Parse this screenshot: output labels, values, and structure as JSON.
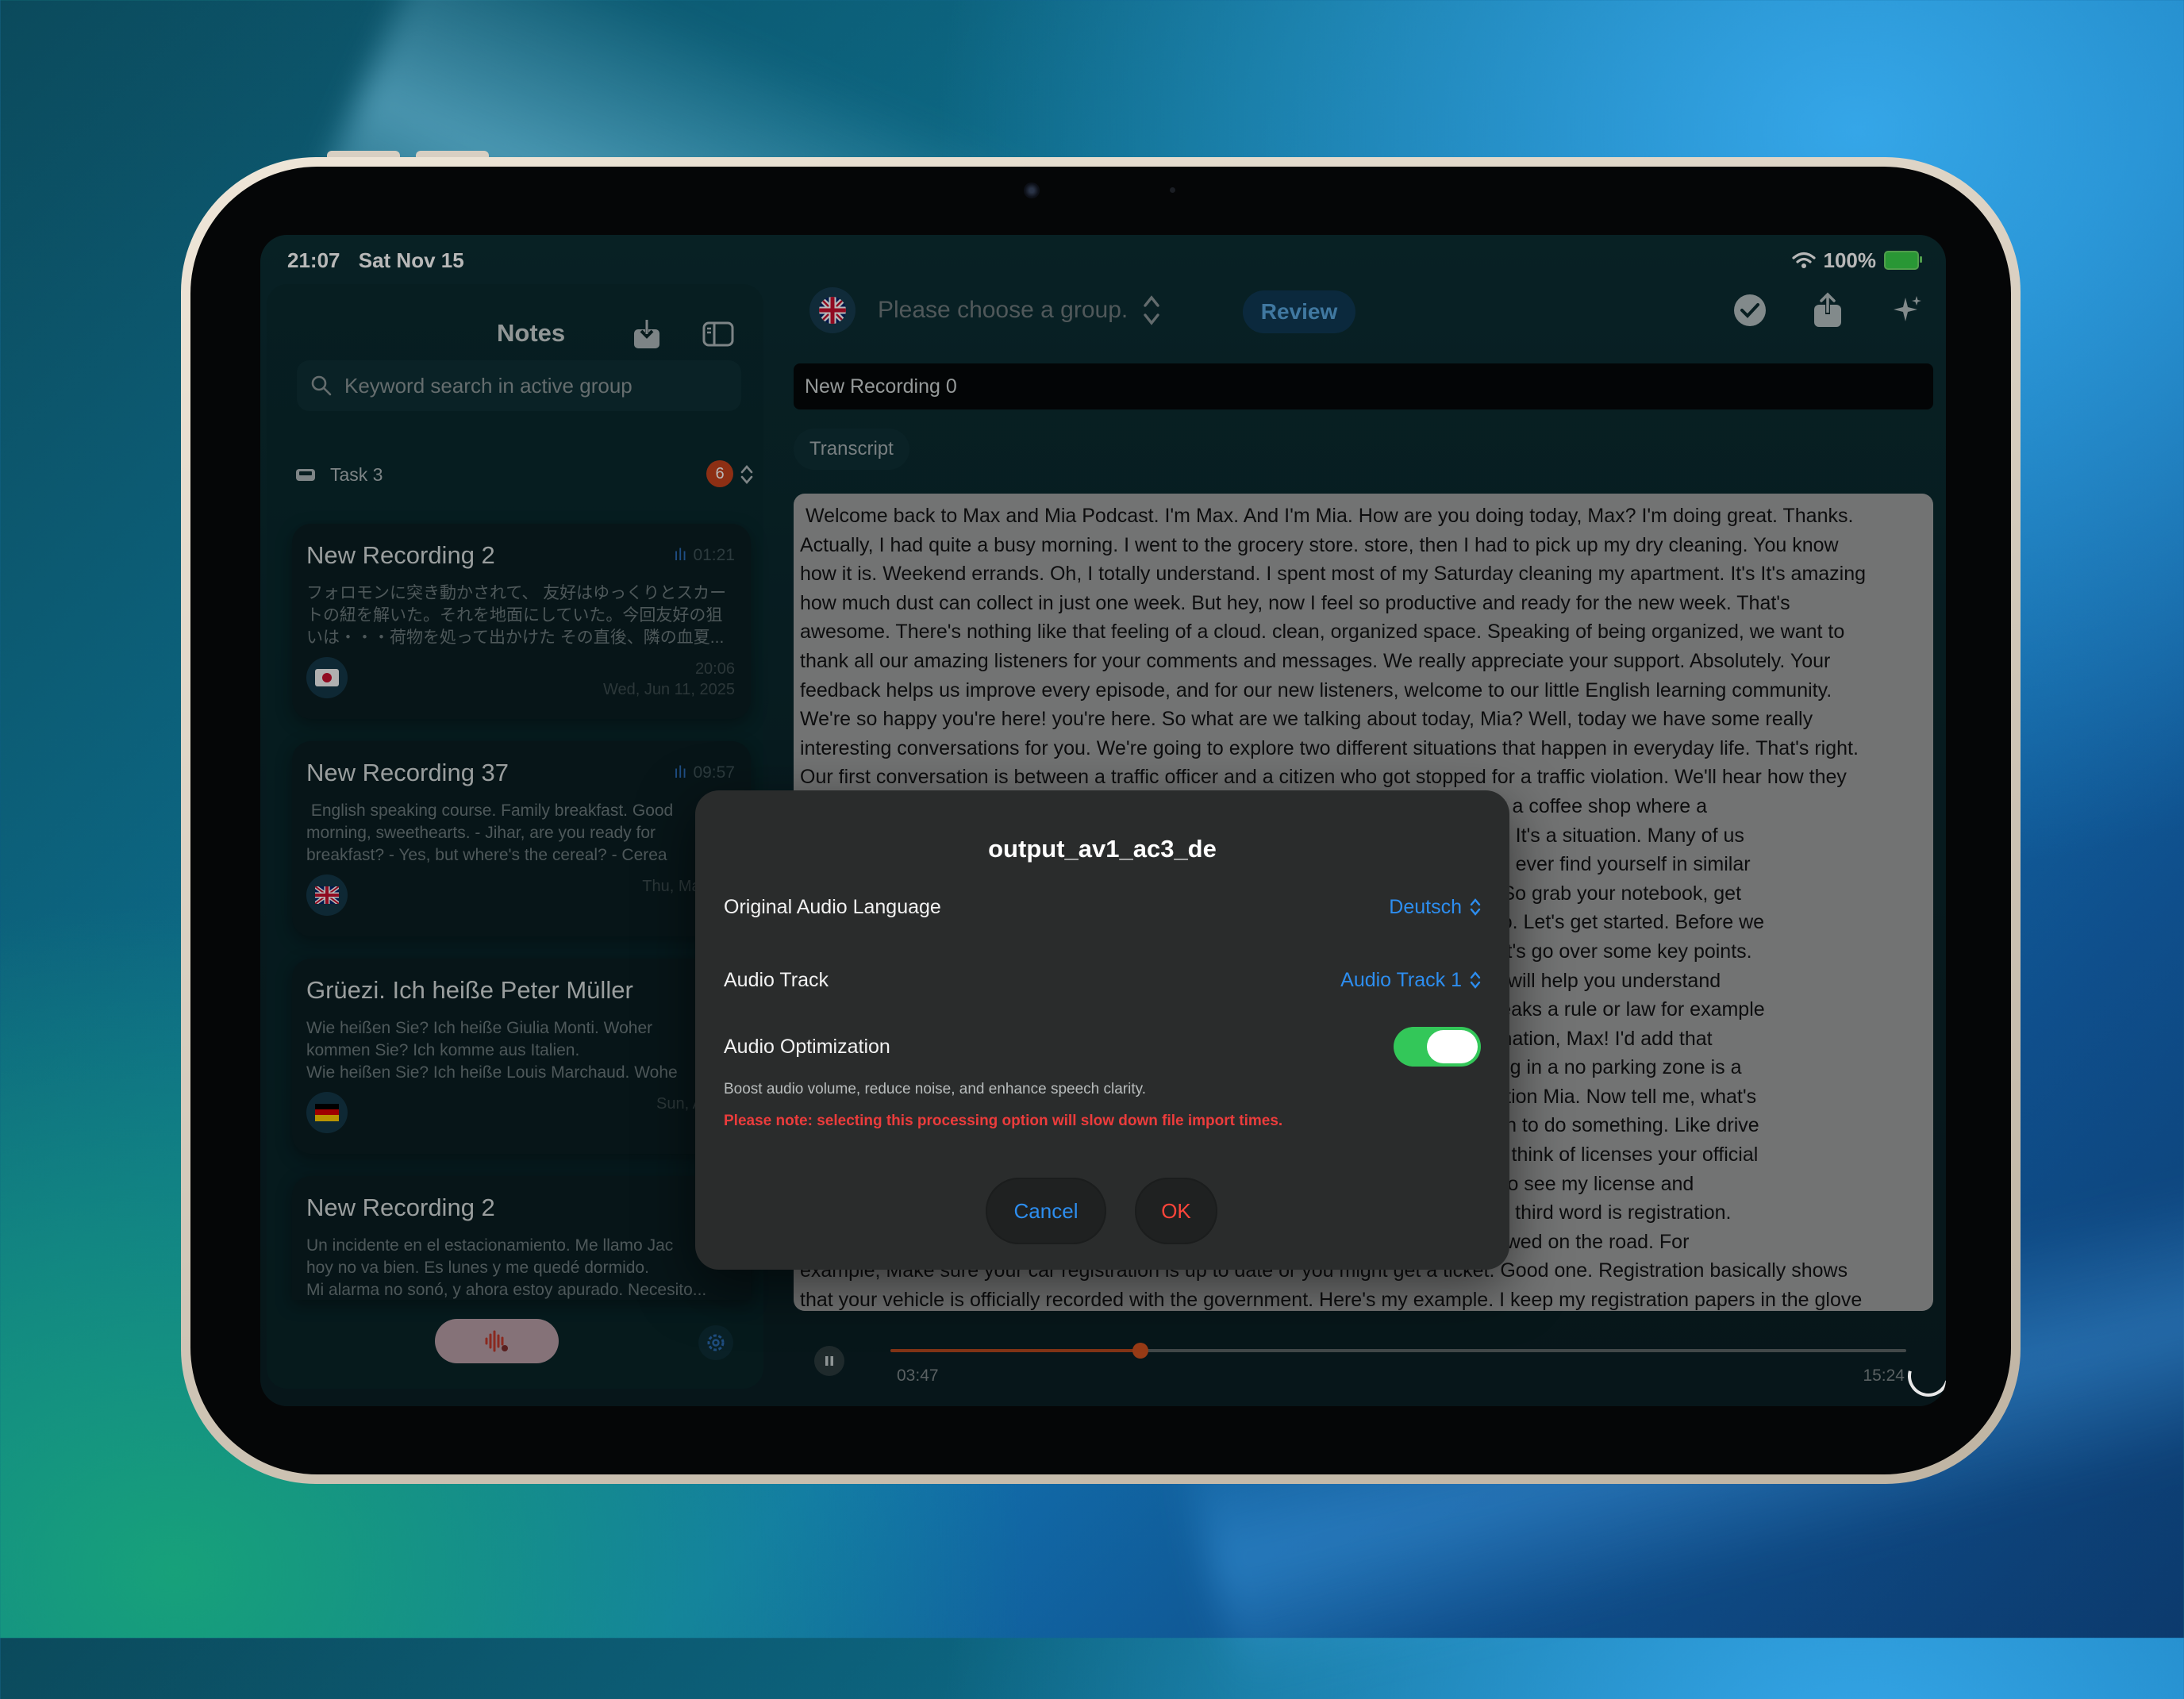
{
  "status_bar": {
    "time": "21:07",
    "date": "Sat Nov 15",
    "battery": "100%"
  },
  "sidebar": {
    "title": "Notes",
    "search_placeholder": "Keyword search in active group",
    "group": {
      "name": "Task 3",
      "count": "6"
    },
    "recordings": [
      {
        "title": "New Recording 2",
        "duration": "01:21",
        "lines": [
          "フォロモンに突き動かされて、 友好はゆっくりとスカー",
          "トの紐を解いた。それを地面にしていた。今回友好の狙",
          "いは・・・荷物を処って出かけた その直後、隣の血夏..."
        ],
        "time": "20:06",
        "date": "Wed, Jun 11, 2025",
        "flag": "jp"
      },
      {
        "title": "New Recording 37",
        "duration": "09:57",
        "lines": [
          " English speaking course. Family breakfast. Good",
          "morning, sweethearts. - Jihar, are you ready for",
          "breakfast? - Yes, but where's the cereal? - Cerea"
        ],
        "time": "",
        "date": "Thu, May 15,",
        "flag": "uk"
      },
      {
        "title": "Grüezi. Ich heiße Peter Müller",
        "duration": "0",
        "lines": [
          "Wie heißen Sie? Ich heiße Giulia Monti. Woher",
          "kommen Sie? Ich komme aus Italien.",
          "Wie heißen Sie? Ich heiße Louis Marchaud. Wohe"
        ],
        "time": "",
        "date": "Sun, Apr 6,",
        "flag": "de"
      },
      {
        "title": "New Recording 2",
        "duration": "0",
        "lines": [
          "Un incidente en el estacionamiento. Me llamo Jac",
          "hoy no va bien. Es lunes y me quedé dormido.",
          "Mi alarma no sonó, y ahora estoy apurado. Necesito..."
        ],
        "time": "",
        "date": "",
        "flag": "es"
      }
    ]
  },
  "toolbar": {
    "group_placeholder": "Please choose a group.",
    "review_label": "Review"
  },
  "main": {
    "recording_title": "New Recording 0",
    "tab_label": "Transcript",
    "transcript_lines": [
      " Welcome back to Max and Mia Podcast. I'm Max. And I'm Mia. How are you doing today, Max? I'm doing great. Thanks.",
      "Actually, I had quite a busy morning. I went to the grocery store. store, then I had to pick up my dry cleaning. You know",
      "how it is. Weekend errands. Oh, I totally understand. I spent most of my Saturday cleaning my apartment. It's It's amazing",
      "how much dust can collect in just one week. But hey, now I feel so productive and ready for the new week. That's",
      "awesome. There's nothing like that feeling of a cloud. clean, organized space. Speaking of being organized, we want to",
      "thank all our amazing listeners for your comments and messages. We really appreciate your support. Absolutely. Your",
      "feedback helps us improve every episode, and for our new listeners, welcome to our little English learning community.",
      "We're so happy you're here! you're here. So what are we talking about today, Mia? Well, today we have some really",
      "interesting conversations for you. We're going to explore two different situations that happen in everyday life. That's right.",
      "Our first conversation is between a traffic officer and a citizen who got stopped for a traffic violation. We'll hear how they",
      "                                                                                                       n takes place at a coffee shop where a",
      "                                                                                                       ayment method. It's a situation. Many of us",
      "                                                                                                       Especially if you ever find yourself in similar",
      "                                                                                                       rward. Exactly. So grab your notebook, get",
      "                                                                                                       n ready. Let's go. Let's get started. Before we",
      "                                                                                                       conversation, let's go over some key points.",
      "                                                                                                       vocabulary that will help you understand",
      "                                                                                                       en someone breaks a rule or law for example",
      "                                                                                                       les Great explanation, Max! I'd add that",
      "                                                                                                       example. Parking in a no parking zone is a",
      "                                                                                                       Perfect explanation Mia. Now tell me, what's",
      "                                                                                                       s you permission to do something. Like drive",
      "                                                                                                       y. Exactly. And I think of licenses your official",
      "                                                                                                       e officer asked to see my license and",
      "                                                                                                       word? max. The third word is registration.",
      "                                                                                                       d it's legally allowed on the road. For",
      "example, Make sure your car registration is up to date or you might get a ticket. Good one. Registration basically shows",
      "that your vehicle is officially recorded with the government. Here's my example. I keep my registration papers in the glove"
    ]
  },
  "player": {
    "current": "03:47",
    "total": "15:24",
    "progress": 0.246
  },
  "dialog": {
    "title": "output_av1_ac3_de",
    "language_label": "Original Audio Language",
    "language_value": "Deutsch",
    "track_label": "Audio Track",
    "track_value": "Audio Track 1",
    "optimization_label": "Audio Optimization",
    "optimization_on": true,
    "hint": "Boost audio volume, reduce noise, and enhance speech clarity.",
    "warning": "Please note: selecting this processing option will slow down file import times.",
    "cancel_label": "Cancel",
    "ok_label": "OK"
  },
  "colors": {
    "accent": "#2d8ef0",
    "toggle_on": "#33c759",
    "warning": "#ec3c3c",
    "progress": "#d2521f",
    "record_button": "#b99ea7"
  },
  "icons": [
    "search-icon",
    "tray-icon",
    "sidebar-toggle-icon",
    "download-icon",
    "chevron-updown-icon",
    "checkmark-circle-icon",
    "share-icon",
    "sparkles-icon",
    "waveform-icon",
    "gear-icon",
    "pause-icon",
    "wifi-icon",
    "battery-icon"
  ]
}
